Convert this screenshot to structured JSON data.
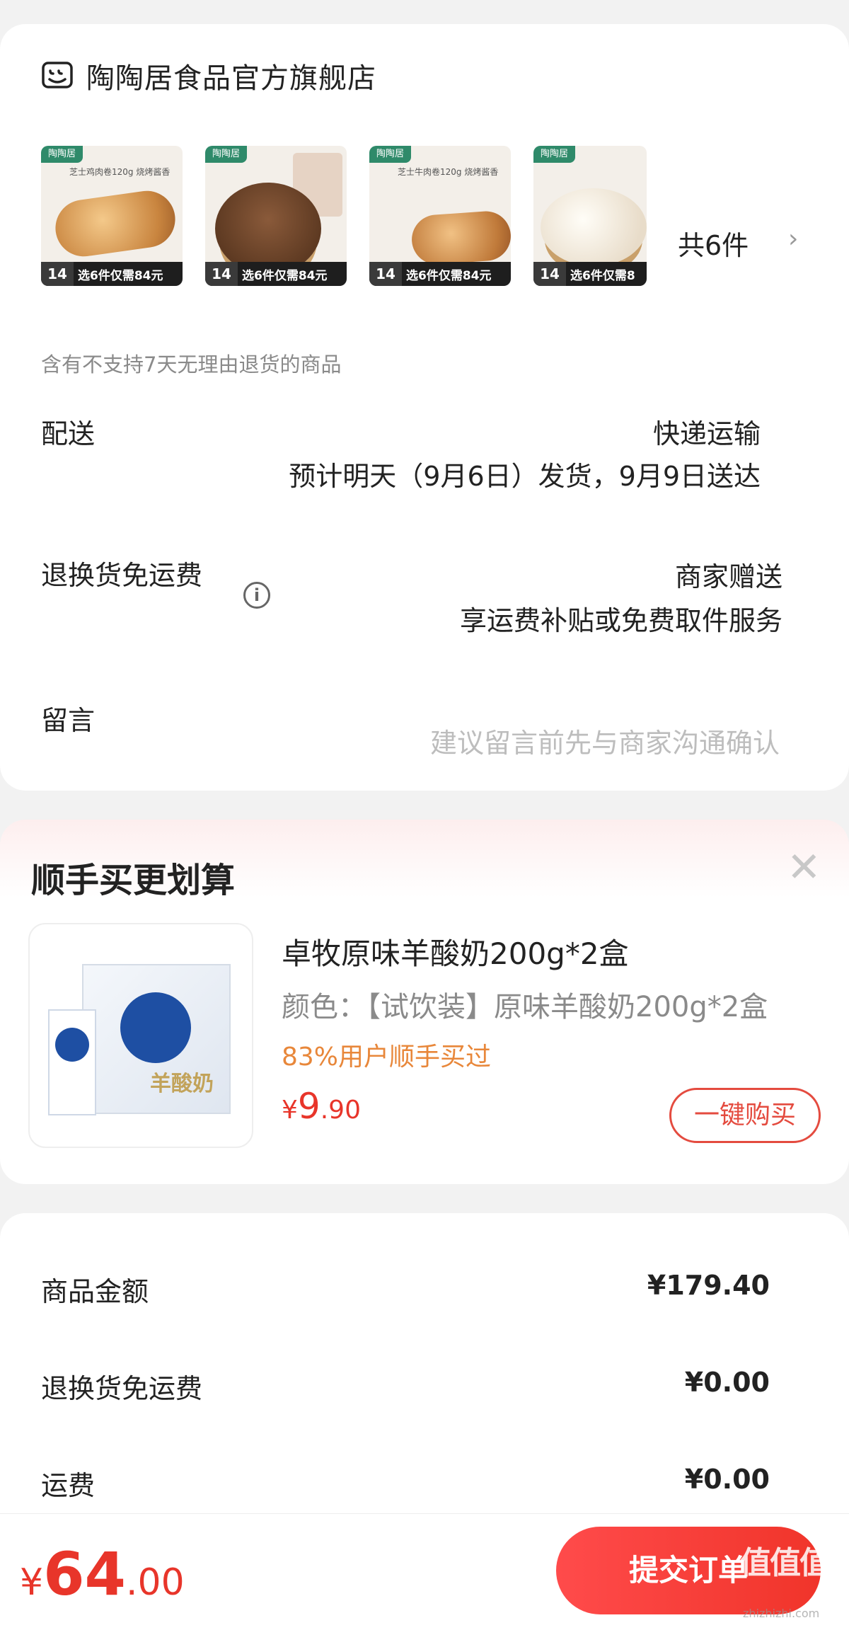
{
  "store": {
    "name": "陶陶居食品官方旗舰店",
    "item_count": "共6件",
    "notice": "含有不支持7天无理由退货的商品",
    "products": [
      {
        "logo": "陶陶居",
        "title": "芝士鸡肉卷120g 烧烤酱香",
        "num": "14",
        "tag": "选6件仅需84元"
      },
      {
        "logo": "陶陶居",
        "title": "",
        "num": "14",
        "tag": "选6件仅需84元"
      },
      {
        "logo": "陶陶居",
        "title": "芝士牛肉卷120g 烧烤酱香",
        "num": "14",
        "tag": "选6件仅需84元"
      },
      {
        "logo": "陶陶居",
        "title": "",
        "num": "14",
        "tag": "选6件仅需8"
      }
    ]
  },
  "delivery": {
    "label": "配送",
    "method": "快递运输",
    "estimate": "预计明天（9月6日）发货，9月9日送达"
  },
  "return_shipping": {
    "label": "退换货免运费",
    "value": "商家赠送",
    "desc": "享运费补贴或免费取件服务"
  },
  "message": {
    "label": "留言",
    "placeholder": "建议留言前先与商家沟通确认"
  },
  "upsell": {
    "title": "顺手买更划算",
    "close": "✕",
    "product_name": "卓牧原味羊酸奶200g*2盒",
    "spec": "颜色：【试饮装】原味羊酸奶200g*2盒",
    "stat": "83%用户顺手买过",
    "price_symbol": "¥",
    "price_int": "9",
    "price_dec": ".90",
    "buy_button": "一键购买",
    "pack_label": "羊酸奶"
  },
  "summary": {
    "rows": [
      {
        "label": "商品金额",
        "value": "¥179.40"
      },
      {
        "label": "退换货免运费",
        "value": "¥0.00"
      },
      {
        "label": "运费",
        "value": "¥0.00"
      }
    ]
  },
  "checkout": {
    "price_symbol": "¥",
    "price_int": "64",
    "price_dec": ".00",
    "submit": "提交订单"
  },
  "watermark": {
    "text": "值值值",
    "sub": "zhizhizhi.com"
  },
  "colors": {
    "accent": "#e8352a",
    "orange": "#e8873a",
    "muted": "#8a8a8a"
  }
}
